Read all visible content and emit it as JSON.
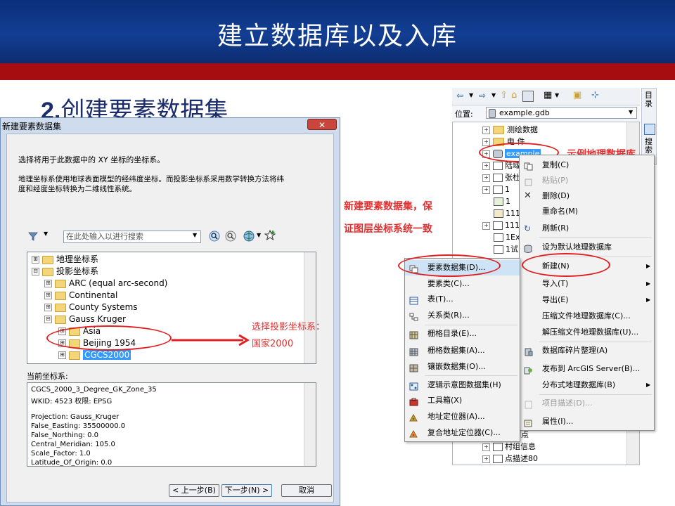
{
  "slide": {
    "title": "建立数据库以及入库",
    "subtitle_num": "2.",
    "subtitle_text": "创建要素数据集"
  },
  "dialog": {
    "title": "新建要素数据集",
    "close": "✕",
    "instruction1": "选择将用于此数据中的 XY 坐标的坐标系。",
    "instruction2": "地理坐标系使用地球表面模型的经纬度坐标。而投影坐标系采用数学转换方法将纬",
    "instruction3": "度和经度坐标转换为二维线性系统。",
    "search_placeholder": "在此处输入以进行搜索",
    "tree": [
      {
        "label": "地理坐标系",
        "pm": "⊞"
      },
      {
        "label": "投影坐标系",
        "pm": "⊟"
      },
      {
        "label": "ARC (equal arc-second)",
        "pm": "⊞"
      },
      {
        "label": "Continental",
        "pm": "⊞"
      },
      {
        "label": "County Systems",
        "pm": "⊞"
      },
      {
        "label": "Gauss Kruger",
        "pm": "⊟"
      },
      {
        "label": "Asia",
        "pm": "⊞"
      },
      {
        "label": "Beijing 1954",
        "pm": "⊞"
      },
      {
        "label": "CGCS2000",
        "pm": "⊞"
      }
    ],
    "current_label": "当前坐标系:",
    "current_lines": [
      "CGCS_2000_3_Degree_GK_Zone_35",
      "WKID: 4523 权限: EPSG",
      "",
      "Projection: Gauss_Kruger",
      "False_Easting: 35500000.0",
      "False_Northing: 0.0",
      "Central_Meridian: 105.0",
      "Scale_Factor: 1.0",
      "Latitude_Of_Origin: 0.0"
    ],
    "btn_back": "< 上一步(B)",
    "btn_next": "下一步(N) >",
    "btn_cancel": "取消"
  },
  "annotations": {
    "choose_proj": "选择投影坐标系：",
    "choose_proj2": "国家2000",
    "new_dataset1": "新建要素数据集，保",
    "new_dataset2": "证图层坐标系统一致",
    "example_db": "示例地理数据库"
  },
  "catalog": {
    "location_label": "位置:",
    "location_value": "example.gdb",
    "rows": [
      {
        "label": "测绘数据"
      },
      {
        "label": "电 件"
      },
      {
        "label": "example"
      },
      {
        "label": "陆域"
      },
      {
        "label": "张杜"
      },
      {
        "label": "1"
      },
      {
        "label": "1"
      },
      {
        "label": "111"
      },
      {
        "label": "111"
      },
      {
        "label": "1Exc"
      },
      {
        "label": "1试"
      }
    ],
    "bottom_rows": [
      {
        "label": "控制点"
      },
      {
        "label": "村组信息"
      },
      {
        "label": "点描述80"
      }
    ],
    "side_tab": "目录",
    "side_tab2": "搜索"
  },
  "context_menu": [
    {
      "label": "复制(C)",
      "icon": "copy-icon",
      "disabled": false
    },
    {
      "label": "粘贴(P)",
      "icon": "paste-icon",
      "disabled": true
    },
    {
      "label": "删除(D)",
      "icon": "delete-icon",
      "disabled": false
    },
    {
      "label": "重命名(M)",
      "icon": "",
      "disabled": false
    },
    {
      "label": "刷新(R)",
      "icon": "refresh-icon",
      "disabled": false
    },
    {
      "label": "设为默认地理数据库",
      "icon": "database-icon",
      "disabled": false
    },
    {
      "label": "新建(N)",
      "icon": "",
      "disabled": false,
      "submenu": true
    },
    {
      "label": "导入(T)",
      "icon": "",
      "disabled": false,
      "submenu": true
    },
    {
      "label": "导出(E)",
      "icon": "",
      "disabled": false,
      "submenu": true
    },
    {
      "label": "压缩文件地理数据库(C)...",
      "icon": "",
      "disabled": false
    },
    {
      "label": "解压缩文件地理数据库(U)...",
      "icon": "",
      "disabled": false
    },
    {
      "label": "数据库碎片整理(A)",
      "icon": "defrag-icon",
      "disabled": false
    },
    {
      "label": "发布到 ArcGIS Server(B)...",
      "icon": "publish-icon",
      "disabled": false
    },
    {
      "label": "分布式地理数据库(B)",
      "icon": "",
      "disabled": false,
      "submenu": true
    },
    {
      "label": "项目描述(D)...",
      "icon": "description-icon",
      "disabled": true
    },
    {
      "label": "属性(I)...",
      "icon": "properties-icon",
      "disabled": false
    }
  ],
  "submenu_new": [
    {
      "label": "要素数据集(D)...",
      "icon": "feature-dataset-icon"
    },
    {
      "label": "要素类(C)...",
      "icon": "feature-class-icon"
    },
    {
      "label": "表(T)...",
      "icon": "table-icon"
    },
    {
      "label": "关系类(R)...",
      "icon": "relationship-icon"
    },
    {
      "label": "栅格目录(E)...",
      "icon": "raster-catalog-icon"
    },
    {
      "label": "栅格数据集(A)...",
      "icon": "raster-dataset-icon"
    },
    {
      "label": "镶嵌数据集(O)...",
      "icon": "mosaic-icon"
    },
    {
      "label": "逻辑示意图数据集(H)",
      "icon": "schematic-icon"
    },
    {
      "label": "工具箱(X)",
      "icon": "toolbox-icon"
    },
    {
      "label": "地址定位器(A)...",
      "icon": "locator-icon"
    },
    {
      "label": "复合地址定位器(C)...",
      "icon": "composite-locator-icon"
    }
  ],
  "colors": {
    "banner": "#123e93",
    "redbar": "#a50d10",
    "annotation": "#e03030",
    "selection": "#3399ff"
  }
}
